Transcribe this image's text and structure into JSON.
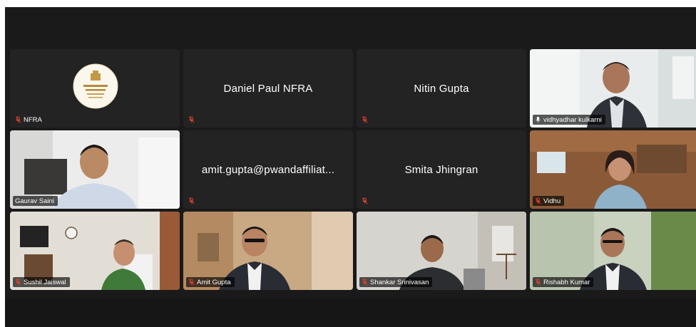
{
  "meeting": {
    "tiles": [
      {
        "name": "NFRA",
        "type": "logo"
      },
      {
        "name": "Daniel Paul NFRA",
        "type": "name-only"
      },
      {
        "name": "Nitin Gupta",
        "type": "name-only"
      },
      {
        "name": "vidhyadhar kulkarni",
        "type": "video",
        "active": true
      },
      {
        "name": "Gaurav Saini",
        "type": "video"
      },
      {
        "name": "amit.gupta@pwandaffiliat...",
        "type": "name-only"
      },
      {
        "name": "Smita Jhingran",
        "type": "name-only"
      },
      {
        "name": "Vidhu",
        "type": "video"
      },
      {
        "name": "Sushil Jaiswal",
        "type": "video"
      },
      {
        "name": "Amit Gupta",
        "type": "video"
      },
      {
        "name": "Shankar Srinivasan",
        "type": "video"
      },
      {
        "name": "Rishabh Kumar",
        "type": "video"
      }
    ],
    "accent_active": "#2dd4a7",
    "muted_mic_color": "#e0442f"
  }
}
